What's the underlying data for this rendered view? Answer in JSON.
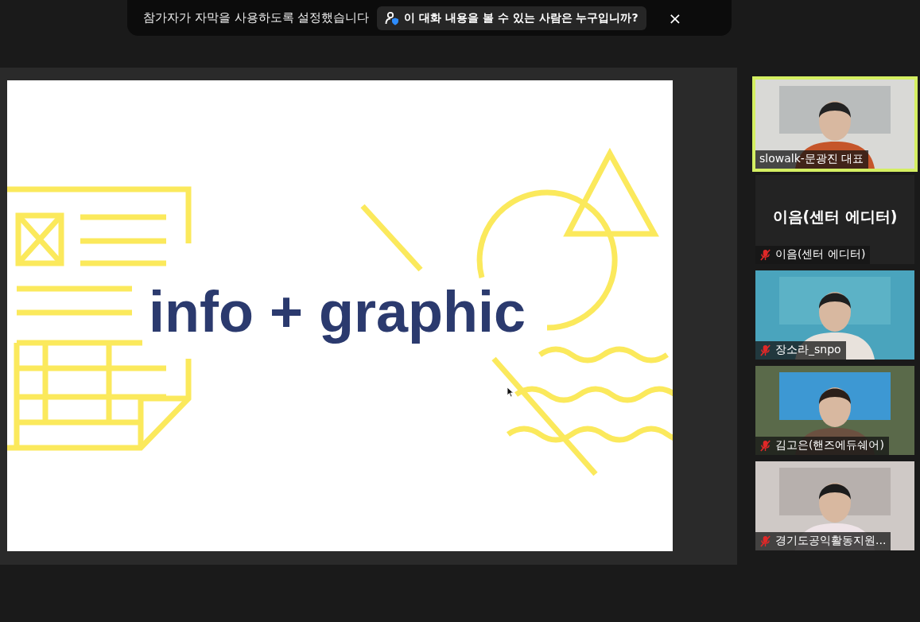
{
  "banner": {
    "message": "참가자가 자막을 사용하도록 설정했습니다",
    "info_button": "이 대화 내용을 볼 수 있는 사람은 누구입니까?",
    "close": "×"
  },
  "slide": {
    "title": "info + graphic"
  },
  "participants": [
    {
      "kind": "video",
      "name": "slowalk-문광진 대표",
      "muted": false,
      "speaking": true
    },
    {
      "kind": "name",
      "display": "이음(센터 에디터)",
      "name": "이음(센터 에디터)",
      "muted": true,
      "speaking": false
    },
    {
      "kind": "video",
      "name": "장소라_snpo",
      "muted": true,
      "speaking": false
    },
    {
      "kind": "video",
      "name": "김고은(핸즈에듀쉐어)",
      "muted": true,
      "speaking": false
    },
    {
      "kind": "video",
      "name": "경기도공익활동지원...",
      "muted": true,
      "speaking": false
    }
  ]
}
